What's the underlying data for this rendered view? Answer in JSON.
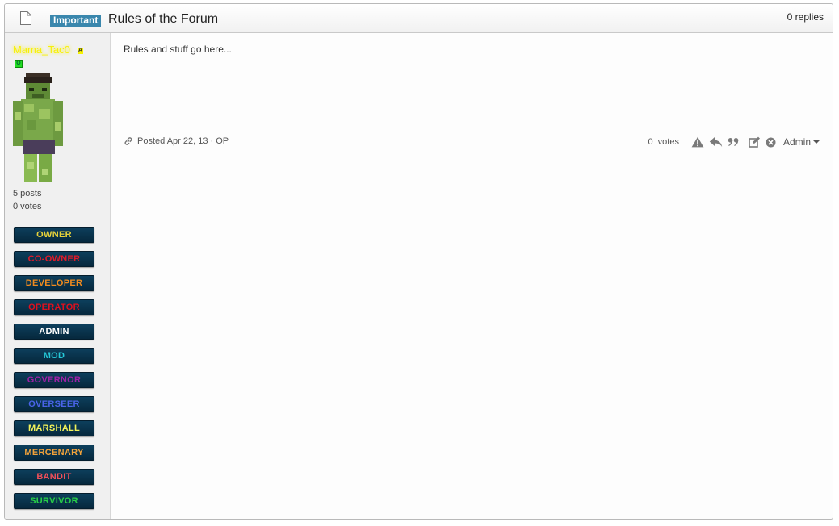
{
  "topic": {
    "badge": "Important",
    "title": "Rules of the Forum",
    "replies": "0 replies"
  },
  "author": {
    "username": "Mama_Tac0",
    "tag_a": "A",
    "tag_o": "O",
    "posts": "5 posts",
    "votes": "0 votes",
    "ranks": [
      {
        "label": "OWNER",
        "color": "#e8d23a"
      },
      {
        "label": "CO-OWNER",
        "color": "#e01b2a"
      },
      {
        "label": "DEVELOPER",
        "color": "#f08a1e"
      },
      {
        "label": "OPERATOR",
        "color": "#e0101e"
      },
      {
        "label": "ADMIN",
        "color": "#ffffff"
      },
      {
        "label": "MOD",
        "color": "#25c8d8"
      },
      {
        "label": "GOVERNOR",
        "color": "#a020a8"
      },
      {
        "label": "OVERSEER",
        "color": "#4a63e8"
      },
      {
        "label": "MARSHALL",
        "color": "#f2f25a"
      },
      {
        "label": "MERCENARY",
        "color": "#f2a23a"
      },
      {
        "label": "BANDIT",
        "color": "#f0505a"
      },
      {
        "label": "SURVIVOR",
        "color": "#28d048"
      }
    ]
  },
  "post": {
    "body": "Rules and stuff go here...",
    "posted": "Posted Apr 22, 13 · OP",
    "votes": "0  votes",
    "admin_label": "Admin"
  },
  "icons": [
    "document-icon",
    "link-icon",
    "report-icon",
    "reply-icon",
    "quote-icon",
    "edit-icon",
    "delete-icon"
  ]
}
